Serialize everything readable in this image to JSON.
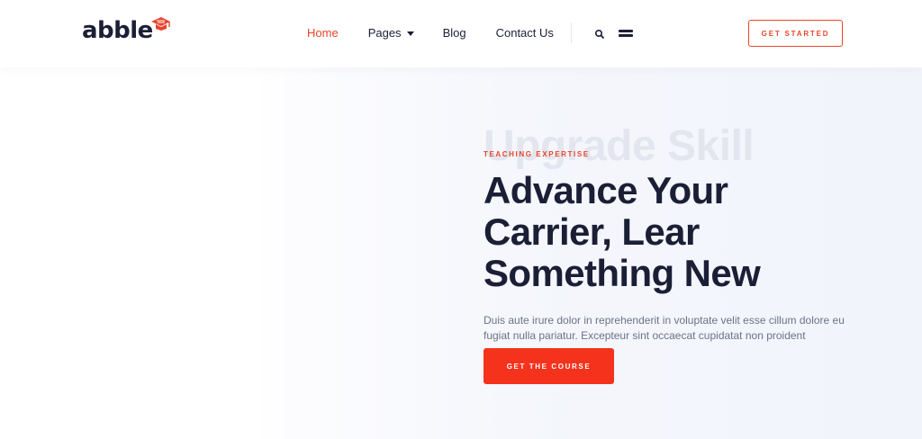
{
  "brand": {
    "name": "abble",
    "accent_color": "#e8452c",
    "text_color": "#1b1f36"
  },
  "nav": {
    "items": [
      {
        "label": "Home",
        "active": true
      },
      {
        "label": "Pages",
        "active": false,
        "has_dropdown": true
      },
      {
        "label": "Blog",
        "active": false
      },
      {
        "label": "Contact Us",
        "active": false
      }
    ]
  },
  "header": {
    "search_icon": "search-icon",
    "menu_icon": "hamburger-menu-icon",
    "cta_label": "GET STARTED"
  },
  "hero": {
    "watermark": "Upgrade Skill",
    "eyebrow": "TEACHING EXPERTISE",
    "headline": {
      "line1": "Advance Your",
      "line2": "Carrier, Lear",
      "line3": "Something New"
    },
    "subtext": {
      "line1": "Duis aute irure dolor in reprehenderit in voluptate velit esse cillum dolore eu",
      "line2": "fugiat nulla pariatur. Excepteur sint occaecat cupidatat non proident"
    },
    "cta_label": "GET THE COURSE",
    "cta_color": "#f5331d"
  }
}
